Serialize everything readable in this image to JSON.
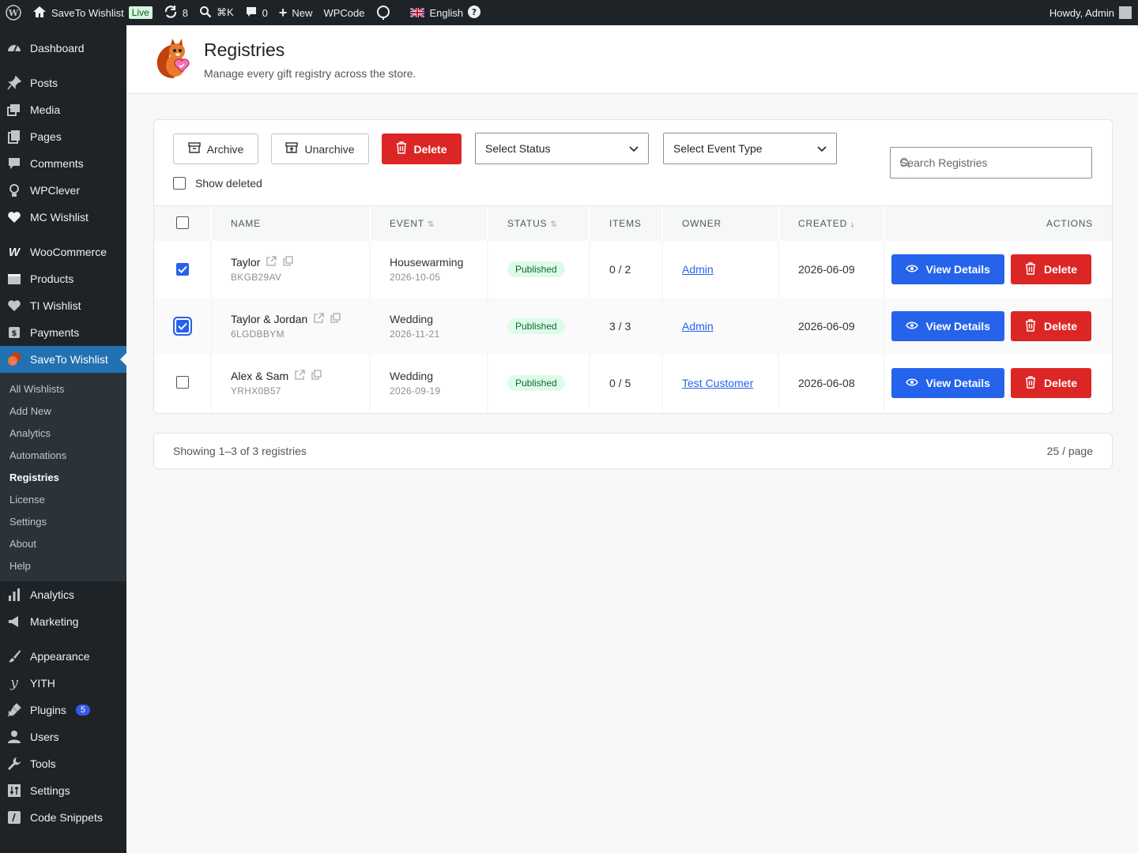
{
  "adminbar": {
    "site_name": "SaveTo Wishlist",
    "live_label": "Live",
    "updates_count": "8",
    "search_shortcut": "⌘K",
    "comments_count": "0",
    "new_label": "New",
    "wpcode_label": "WPCode",
    "language": "English",
    "greeting": "Howdy, Admin"
  },
  "sidebar": {
    "items": [
      {
        "label": "Dashboard",
        "icon": "dashboard-icon"
      },
      {
        "label": "Posts",
        "icon": "pin-icon"
      },
      {
        "label": "Media",
        "icon": "media-icon"
      },
      {
        "label": "Pages",
        "icon": "pages-icon"
      },
      {
        "label": "Comments",
        "icon": "comment-icon"
      },
      {
        "label": "WPClever",
        "icon": "bulb-icon"
      },
      {
        "label": "MC Wishlist",
        "icon": "heart-icon"
      },
      {
        "label": "WooCommerce",
        "icon": "woo-icon"
      },
      {
        "label": "Products",
        "icon": "products-icon"
      },
      {
        "label": "TI Wishlist",
        "icon": "heart-icon"
      },
      {
        "label": "Payments",
        "icon": "payments-icon"
      },
      {
        "label": "SaveTo Wishlist",
        "icon": "squirrel-icon"
      }
    ],
    "submenu": [
      "All Wishlists",
      "Add New",
      "Analytics",
      "Automations",
      "Registries",
      "License",
      "Settings",
      "About",
      "Help"
    ],
    "bottom_items": [
      {
        "label": "Analytics",
        "icon": "bar-chart-icon"
      },
      {
        "label": "Marketing",
        "icon": "megaphone-icon"
      },
      {
        "label": "Appearance",
        "icon": "brush-icon"
      },
      {
        "label": "YITH",
        "icon": "yith-icon"
      },
      {
        "label": "Plugins",
        "icon": "plugin-icon",
        "badge": "5"
      },
      {
        "label": "Users",
        "icon": "user-icon"
      },
      {
        "label": "Tools",
        "icon": "wrench-icon"
      },
      {
        "label": "Settings",
        "icon": "settings-icon"
      },
      {
        "label": "Code Snippets",
        "icon": "code-icon"
      }
    ]
  },
  "header": {
    "title": "Registries",
    "subtitle": "Manage every gift registry across the store."
  },
  "toolbar": {
    "archive_label": "Archive",
    "unarchive_label": "Unarchive",
    "delete_label": "Delete",
    "status_select": "Select Status",
    "event_select": "Select Event Type",
    "search_placeholder": "Search Registries",
    "show_deleted_label": "Show deleted"
  },
  "table": {
    "columns": {
      "name": "NAME",
      "event": "EVENT",
      "status": "STATUS",
      "items": "ITEMS",
      "owner": "OWNER",
      "created": "CREATED",
      "actions": "ACTIONS"
    },
    "view_label": "View Details",
    "delete_label": "Delete",
    "rows": [
      {
        "name": "Taylor",
        "code": "BKGB29AV",
        "event": "Housewarming",
        "event_date": "2026-10-05",
        "status": "Published",
        "items": "0 / 2",
        "owner": "Admin",
        "created": "2026-06-09",
        "checked": true
      },
      {
        "name": "Taylor & Jordan",
        "code": "6LGDBBYM",
        "event": "Wedding",
        "event_date": "2026-11-21",
        "status": "Published",
        "items": "3 / 3",
        "owner": "Admin",
        "created": "2026-06-09",
        "checked": true
      },
      {
        "name": "Alex & Sam",
        "code": "YRHX0B57",
        "event": "Wedding",
        "event_date": "2026-09-19",
        "status": "Published",
        "items": "0 / 5",
        "owner": "Test Customer",
        "created": "2026-06-08",
        "checked": false
      }
    ]
  },
  "footer": {
    "summary": "Showing 1–3 of 3 registries",
    "per_page": "25 / page"
  },
  "colors": {
    "admin_bg": "#1d2327",
    "accent": "#2271b1",
    "primary": "#2563eb",
    "danger": "#dc2626",
    "success_bg": "#dcfce7"
  }
}
